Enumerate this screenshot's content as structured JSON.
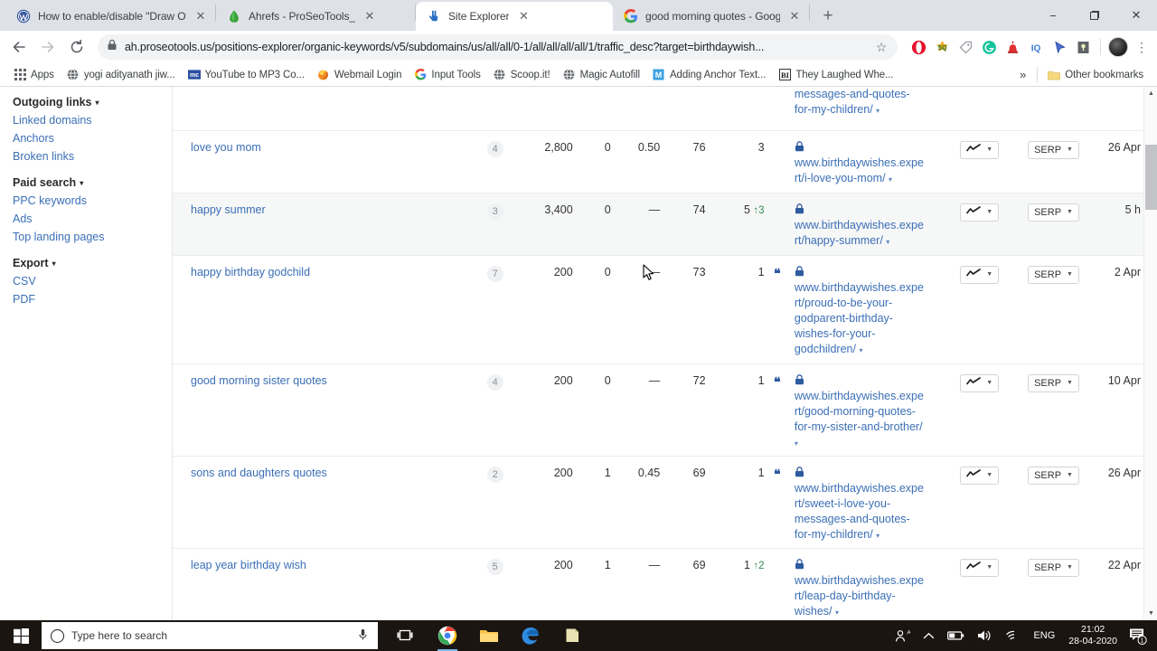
{
  "browser": {
    "tabs": [
      {
        "title": "How to enable/disable \"Draw Ov",
        "favicon": "wordpress-icon",
        "active": false
      },
      {
        "title": "Ahrefs - ProSeoTools_",
        "favicon": "ahrefs-icon",
        "active": false
      },
      {
        "title": "Site Explorer",
        "favicon": "site-explorer-icon",
        "active": true
      },
      {
        "title": "good morning quotes - Google S",
        "favicon": "google-icon",
        "active": false
      }
    ],
    "new_tab_label": "+",
    "window_controls": {
      "minimize": "−",
      "maximize": "❐",
      "close": "✕"
    },
    "omnibox": {
      "url": "ah.proseotools.us/positions-explorer/organic-keywords/v5/subdomains/us/all/all/0-1/all/all/all/all/1/traffic_desc?target=birthdaywish...",
      "lock": "lock-icon",
      "star": "☆"
    },
    "nav": {
      "back": "←",
      "forward": "→",
      "reload": "⟳"
    },
    "extensions": [
      "opera-icon",
      "seoquake-icon",
      "tag-icon",
      "grammarly-icon",
      "alarm-icon",
      "iq-icon",
      "cursor-icon",
      "keyword-icon"
    ],
    "kebab": "⋮",
    "bookmarks": [
      {
        "label": "Apps",
        "icon": "apps-grid-icon"
      },
      {
        "label": "yogi adityanath jiw...",
        "icon": "globe-icon"
      },
      {
        "label": "YouTube to MP3 Co...",
        "icon": "mc-icon"
      },
      {
        "label": "Webmail Login",
        "icon": "firefox-icon"
      },
      {
        "label": "Input Tools",
        "icon": "google-g-icon"
      },
      {
        "label": "Scoop.it!",
        "icon": "globe-icon"
      },
      {
        "label": "Magic Autofill",
        "icon": "globe-icon"
      },
      {
        "label": "Adding Anchor Text...",
        "icon": "m-blue-icon"
      },
      {
        "label": "They Laughed Whe...",
        "icon": "bi-icon"
      }
    ],
    "bookmarks_overflow": "»",
    "other_bookmarks": {
      "label": "Other bookmarks",
      "icon": "folder-icon"
    }
  },
  "sidebar": {
    "groups": [
      {
        "title": "Outgoing links",
        "caret": "▾",
        "links": [
          "Linked domains",
          "Anchors",
          "Broken links"
        ]
      },
      {
        "title": "Paid search",
        "caret": "▾",
        "links": [
          "PPC keywords",
          "Ads",
          "Top landing pages"
        ]
      },
      {
        "title": "Export",
        "caret": "▾",
        "links": [
          "CSV",
          "PDF"
        ]
      }
    ]
  },
  "table": {
    "partial_top_row": {
      "url_lines": [
        "messages-and-quotes-",
        "for-my-children/"
      ],
      "caret": "▾"
    },
    "rows": [
      {
        "keyword": "love you mom",
        "sf": "4",
        "volume": "2,800",
        "kd": "0",
        "cpc": "0.50",
        "traffic": "76",
        "position": "3",
        "position_change": "",
        "quote": false,
        "lock": "lock-icon",
        "url_lines": [
          "www.birthdaywishes.expe",
          "rt/i-love-you-mom/"
        ],
        "url_caret": "▾",
        "chart_button": "sparkline-icon",
        "serp_button": "SERP",
        "updated": "26 Apr",
        "hover": false
      },
      {
        "keyword": "happy summer",
        "sf": "3",
        "volume": "3,400",
        "kd": "0",
        "cpc": "—",
        "traffic": "74",
        "position": "5",
        "position_change": "↑3",
        "quote": false,
        "lock": "lock-icon",
        "url_lines": [
          "www.birthdaywishes.expe",
          "rt/happy-summer/"
        ],
        "url_caret": "▾",
        "chart_button": "sparkline-icon",
        "serp_button": "SERP",
        "updated": "5 h",
        "hover": true
      },
      {
        "keyword": "happy birthday godchild",
        "sf": "7",
        "volume": "200",
        "kd": "0",
        "cpc": "—",
        "traffic": "73",
        "position": "1",
        "position_change": "",
        "quote": true,
        "lock": "lock-icon",
        "url_lines": [
          "www.birthdaywishes.expe",
          "rt/proud-to-be-your-",
          "godparent-birthday-",
          "wishes-for-your-",
          "godchildren/"
        ],
        "url_caret": "▾",
        "chart_button": "sparkline-icon",
        "serp_button": "SERP",
        "updated": "2 Apr",
        "hover": false
      },
      {
        "keyword": "good morning sister quotes",
        "sf": "4",
        "volume": "200",
        "kd": "0",
        "cpc": "—",
        "traffic": "72",
        "position": "1",
        "position_change": "",
        "quote": true,
        "lock": "lock-icon",
        "url_lines": [
          "www.birthdaywishes.expe",
          "rt/good-morning-quotes-",
          "for-my-sister-and-brother/"
        ],
        "url_caret": "▾",
        "chart_button": "sparkline-icon",
        "serp_button": "SERP",
        "updated": "10 Apr",
        "hover": false
      },
      {
        "keyword": "sons and daughters quotes",
        "sf": "2",
        "volume": "200",
        "kd": "1",
        "cpc": "0.45",
        "traffic": "69",
        "position": "1",
        "position_change": "",
        "quote": true,
        "lock": "lock-icon",
        "url_lines": [
          "www.birthdaywishes.expe",
          "rt/sweet-i-love-you-",
          "messages-and-quotes-",
          "for-my-children/"
        ],
        "url_caret": "▾",
        "chart_button": "sparkline-icon",
        "serp_button": "SERP",
        "updated": "26 Apr",
        "hover": false
      },
      {
        "keyword": "leap year birthday wish",
        "sf": "5",
        "volume": "200",
        "kd": "1",
        "cpc": "—",
        "traffic": "69",
        "position": "1",
        "position_change": "↑2",
        "quote": false,
        "lock": "lock-icon",
        "url_lines": [
          "www.birthdaywishes.expe",
          "rt/leap-day-birthday-",
          "wishes/"
        ],
        "url_caret": "▾",
        "chart_button": "sparkline-icon",
        "serp_button": "SERP",
        "updated": "22 Apr",
        "hover": false
      }
    ]
  },
  "taskbar": {
    "search_placeholder": "Type here to search",
    "apps": [
      "task-view-icon",
      "chrome-icon",
      "file-explorer-icon",
      "edge-icon",
      "notepad-icon"
    ],
    "tray": {
      "people": "people-icon",
      "chevron": "⌃",
      "battery": "battery-icon",
      "volume": "volume-icon",
      "wifi": "wifi-icon",
      "language": "ENG"
    },
    "clock": {
      "time": "21:02",
      "date": "28-04-2020"
    },
    "notification_count": "1"
  },
  "colors": {
    "link": "#3b6fb6",
    "accent_blue": "#2d5ba0",
    "up_green": "#2e8b4f",
    "row_hover": "#f6f7f7",
    "taskbar_bg": "#1b1511"
  }
}
